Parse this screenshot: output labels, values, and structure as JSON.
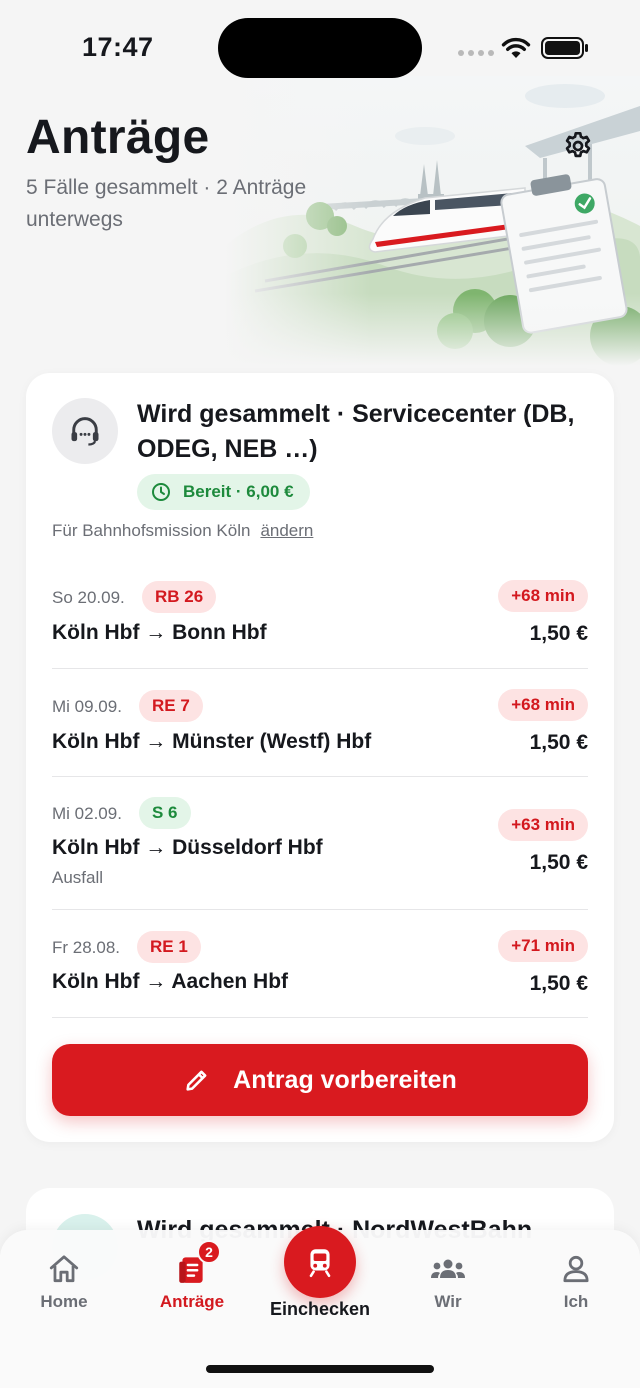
{
  "status_bar": {
    "time": "17:47"
  },
  "header": {
    "title": "Anträge",
    "subtitle": "5 Fälle gesammelt · 2 Anträge unterwegs"
  },
  "case_card": {
    "title": "Wird gesammelt · Servicecenter (DB, ODEG, NEB …)",
    "badge": "Bereit · 6,00 €",
    "org_prefix": "Für Bahnhofsmission Köln",
    "org_change": "ändern",
    "trips": [
      {
        "date": "So 20.09.",
        "line": "RB 26",
        "line_color": "red",
        "route": "Köln Hbf → Bonn Hbf",
        "note": "",
        "delay": "+68 min",
        "amount": "1,50 €"
      },
      {
        "date": "Mi 09.09.",
        "line": "RE 7",
        "line_color": "red",
        "route": "Köln Hbf → Münster (Westf) Hbf",
        "note": "",
        "delay": "+68 min",
        "amount": "1,50 €"
      },
      {
        "date": "Mi 02.09.",
        "line": "S 6",
        "line_color": "green",
        "route": "Köln Hbf → Düsseldorf Hbf",
        "note": "Ausfall",
        "delay": "+63 min",
        "amount": "1,50 €"
      },
      {
        "date": "Fr 28.08.",
        "line": "RE 1",
        "line_color": "red",
        "route": "Köln Hbf → Aachen Hbf",
        "note": "",
        "delay": "+71 min",
        "amount": "1,50 €"
      }
    ],
    "action_label": "Antrag vorbereiten"
  },
  "next_card": {
    "title": "Wird gesammelt · NordWestBahn"
  },
  "tab_bar": {
    "tabs": [
      {
        "label": "Home",
        "icon": "home-icon"
      },
      {
        "label": "Anträge",
        "icon": "document-icon",
        "badge": "2",
        "active": true
      },
      {
        "label": "Einchecken",
        "icon": "train-icon"
      },
      {
        "label": "Wir",
        "icon": "group-icon"
      },
      {
        "label": "Ich",
        "icon": "person-icon"
      }
    ]
  },
  "colors": {
    "accent": "#d91a1f",
    "success": "#1d8a3c",
    "muted": "#6b6e75",
    "background": "#f5f5f5"
  }
}
